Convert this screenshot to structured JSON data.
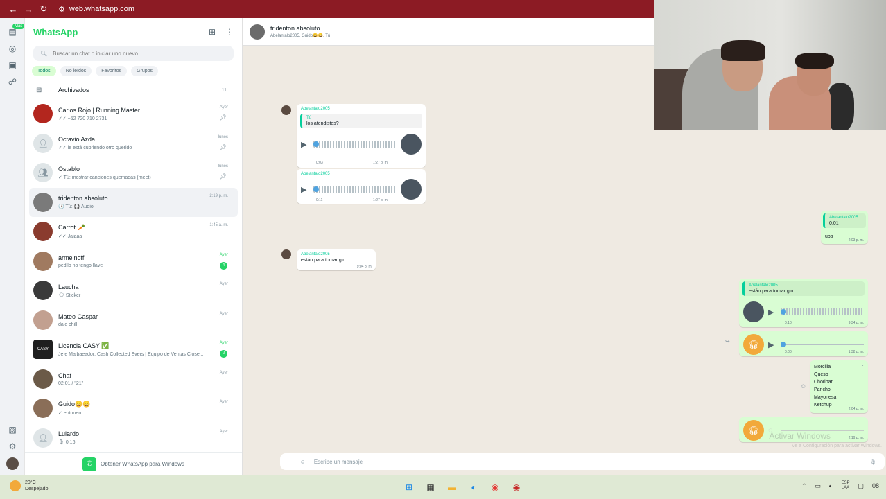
{
  "browser": {
    "url": "web.whatsapp.com"
  },
  "rail": {
    "new_badge": "Más"
  },
  "sidebar": {
    "title": "WhatsApp",
    "search_placeholder": "Buscar un chat o iniciar uno nuevo",
    "filters": [
      "Todos",
      "No leídos",
      "Favoritos",
      "Grupos"
    ],
    "archived": {
      "label": "Archivados",
      "count": "11"
    },
    "chats": [
      {
        "name": "Carlos Rojo | Running Master",
        "preview": "✓✓ +52 720 710 2731",
        "time": "Ayer",
        "pinned": true
      },
      {
        "name": "Octavio Azda",
        "preview": "✓✓ le está cubriendo otro querido",
        "time": "lunes",
        "pinned": true
      },
      {
        "name": "Ostablo",
        "preview": "✓ Tú: mostrar canciones quemadas (meet)",
        "time": "lunes",
        "pinned": true
      },
      {
        "name": "tridenton absoluto",
        "preview": "🕒 Tú: 🎧 Audio",
        "time": "2:19 p. m.",
        "selected": true
      },
      {
        "name": "Carrot 🥕",
        "preview": "✓✓ Jajaaa",
        "time": "1:45 a. m."
      },
      {
        "name": "armelnoff",
        "preview": "pedilo no tengo llave",
        "time": "Ayer",
        "unread": "4"
      },
      {
        "name": "Laucha",
        "preview": "🗨 Sticker",
        "time": "Ayer"
      },
      {
        "name": "Mateo Gaspar",
        "preview": "dale chill",
        "time": "Ayer"
      },
      {
        "name": "Licencia CASY ✅",
        "preview": "Jefe Malbaeador: Cash Collected Evers | Equipo de Ventas Close...",
        "time": "Ayer",
        "unread": "2"
      },
      {
        "name": "Chaf",
        "preview": "02:01 / \"21\"",
        "time": "Ayer"
      },
      {
        "name": "Guido😀😀",
        "preview": "✓ entonen",
        "time": "Ayer"
      },
      {
        "name": "Lulardo",
        "preview": "🎙 0:16",
        "time": "Ayer"
      }
    ],
    "get_app": "Obtener WhatsApp para Windows"
  },
  "conversation": {
    "title": "tridenton absoluto",
    "subtitle": "Abelantalo2005, Guido😀😀, Tú",
    "messages": {
      "m1_sender": "Abelantalo2005",
      "m1_quote_name": "Tú",
      "m1_quote_text": "los atendistes?",
      "m1_dur": "0:03",
      "m1_time": "1:27 p. m.",
      "m2_sender": "Abelantalo2005",
      "m2_dur": "0:11",
      "m2_time": "1:27 p. m.",
      "m3_sender": "Abelantalo2005",
      "m3_dur": "0:01",
      "m3_text": "upa",
      "m3_time": "2:03 p. m.",
      "m4_sender": "Abelantalo2005",
      "m4_text": "están para tomar gin",
      "m4_time": "9:04 p. m.",
      "m5_quote_name": "Abelantalo2005",
      "m5_quote_text": "están para tomar gin",
      "m5_dur": "0:10",
      "m5_time": "9:34 p. m.",
      "m6_dur": "0:00",
      "m6_time": "1:38 p. m.",
      "m7_list": [
        "Morcilla",
        "Queso",
        "Choripan",
        "Pancho",
        "Mayonesa",
        "Ketchup"
      ],
      "m7_time": "2:04 p. m.",
      "m8_time": "2:19 p. m."
    },
    "input_placeholder": "Escribe un mensaje",
    "watermark": "Activar Windows",
    "watermark_sub": "Ve a Configuración para activar Windows."
  },
  "taskbar": {
    "temp": "20°C",
    "weather": "Despejado",
    "lang_top": "ESP",
    "lang_bottom": "LAA",
    "time": "08"
  },
  "colors": {
    "brand": "#25d366",
    "browser_bar": "#8c1b24",
    "outgoing": "#d9fdd3",
    "wallpaper": "#efeae2"
  }
}
